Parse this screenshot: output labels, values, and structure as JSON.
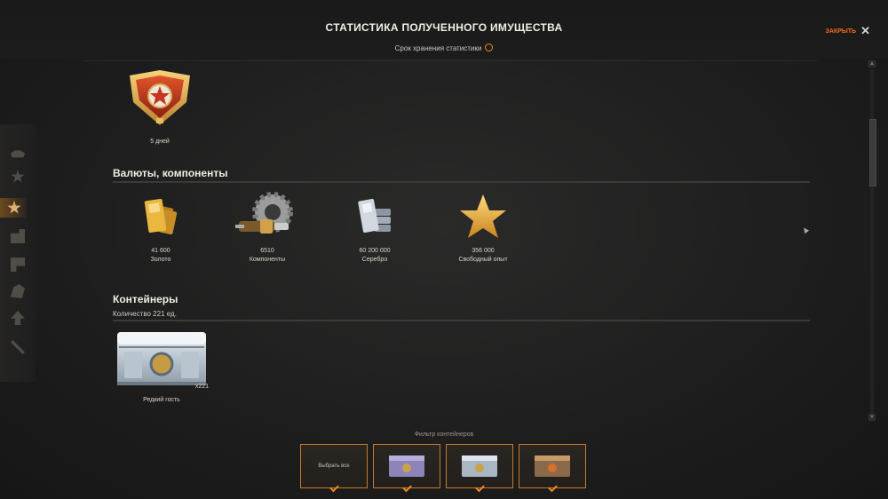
{
  "header": {
    "title": "СТАТИСТИКА ПОЛУЧЕННОГО ИМУЩЕСТВА",
    "subtitle": "Срок хранения статистики",
    "close_label": "ЗАКРЫТЬ"
  },
  "premium": {
    "caption": "5 дней"
  },
  "currencies": {
    "title": "Валюты, компоненты",
    "items": [
      {
        "value": "41 600",
        "label": "Золото",
        "icon": "gold-bars-icon"
      },
      {
        "value": "6510",
        "label": "Компоненты",
        "icon": "components-icon"
      },
      {
        "value": "60 200 000",
        "label": "Серебро",
        "icon": "silver-bars-icon"
      },
      {
        "value": "356 000",
        "label": "Свободный опыт",
        "icon": "star-icon"
      }
    ]
  },
  "containers": {
    "title": "Контейнеры",
    "count_text": "Количество 221 ед.",
    "items": [
      {
        "name": "Редкий гость",
        "count": "x221",
        "icon": "steel-crate-icon"
      }
    ]
  },
  "filter": {
    "label": "Фильтр контейнеров",
    "select_all": "Выбрать все",
    "options": [
      "purple-crate-icon",
      "steel-crate-icon",
      "bronze-crate-icon"
    ]
  },
  "colors": {
    "accent": "#f58a1f",
    "gold": "#e3ad3c",
    "premium_red": "#c8361d"
  }
}
